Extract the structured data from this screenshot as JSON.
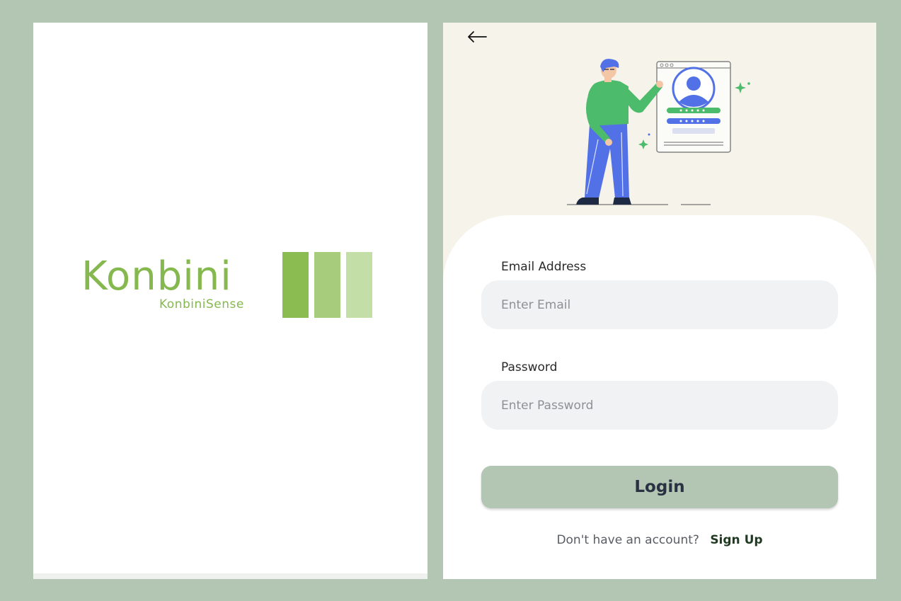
{
  "splash": {
    "logo_word": "Konbini",
    "logo_tagline": "KonbiniSense",
    "brand_colors": [
      "#8bbc51",
      "#a6cc7c",
      "#c3dea6"
    ]
  },
  "login": {
    "back_icon": "arrow-left-icon",
    "illustration": "person-with-login-screen-illustration",
    "email": {
      "label": "Email Address",
      "placeholder": "Enter Email",
      "value": ""
    },
    "password": {
      "label": "Password",
      "placeholder": "Enter Password",
      "value": ""
    },
    "login_button": "Login",
    "signup_prompt": "Don't have an account?",
    "signup_link": "Sign Up"
  },
  "colors": {
    "frame": "#b3c5b3",
    "button": "#b3c5b3",
    "header_bg": "#f6f3ea",
    "accent_green": "#4cbb6b",
    "accent_blue": "#5271e6"
  }
}
